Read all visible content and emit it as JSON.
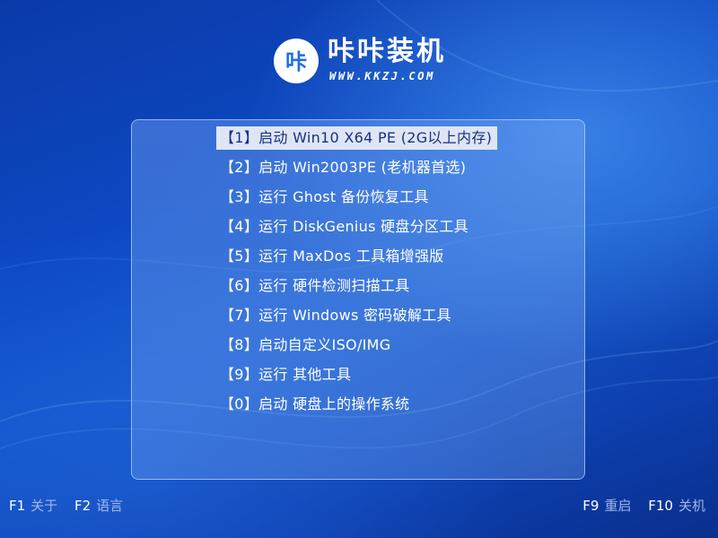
{
  "brand": {
    "logo_glyph": "咔",
    "title": "咔咔装机",
    "url": "WWW.KKZJ.COM"
  },
  "menu": {
    "selected_index": 0,
    "items": [
      {
        "label": "【1】启动 Win10 X64 PE (2G以上内存)"
      },
      {
        "label": "【2】启动 Win2003PE (老机器首选)"
      },
      {
        "label": "【3】运行 Ghost 备份恢复工具"
      },
      {
        "label": "【4】运行 DiskGenius 硬盘分区工具"
      },
      {
        "label": "【5】运行 MaxDos 工具箱增强版"
      },
      {
        "label": "【6】运行 硬件检测扫描工具"
      },
      {
        "label": "【7】运行 Windows 密码破解工具"
      },
      {
        "label": "【8】启动自定义ISO/IMG"
      },
      {
        "label": "【9】运行 其他工具"
      },
      {
        "label": "【0】启动 硬盘上的操作系统"
      }
    ]
  },
  "footer": {
    "left": [
      {
        "key": "F1",
        "label": "关于"
      },
      {
        "key": "F2",
        "label": "语言"
      }
    ],
    "right": [
      {
        "key": "F9",
        "label": "重启"
      },
      {
        "key": "F10",
        "label": "关机"
      }
    ]
  },
  "colors": {
    "background": "#0d49c4",
    "selected_bg": "#dfe6f3",
    "selected_text": "#1b2f86",
    "hint_label": "#9fb6e6",
    "logo_icon": "#1b6fe0"
  }
}
